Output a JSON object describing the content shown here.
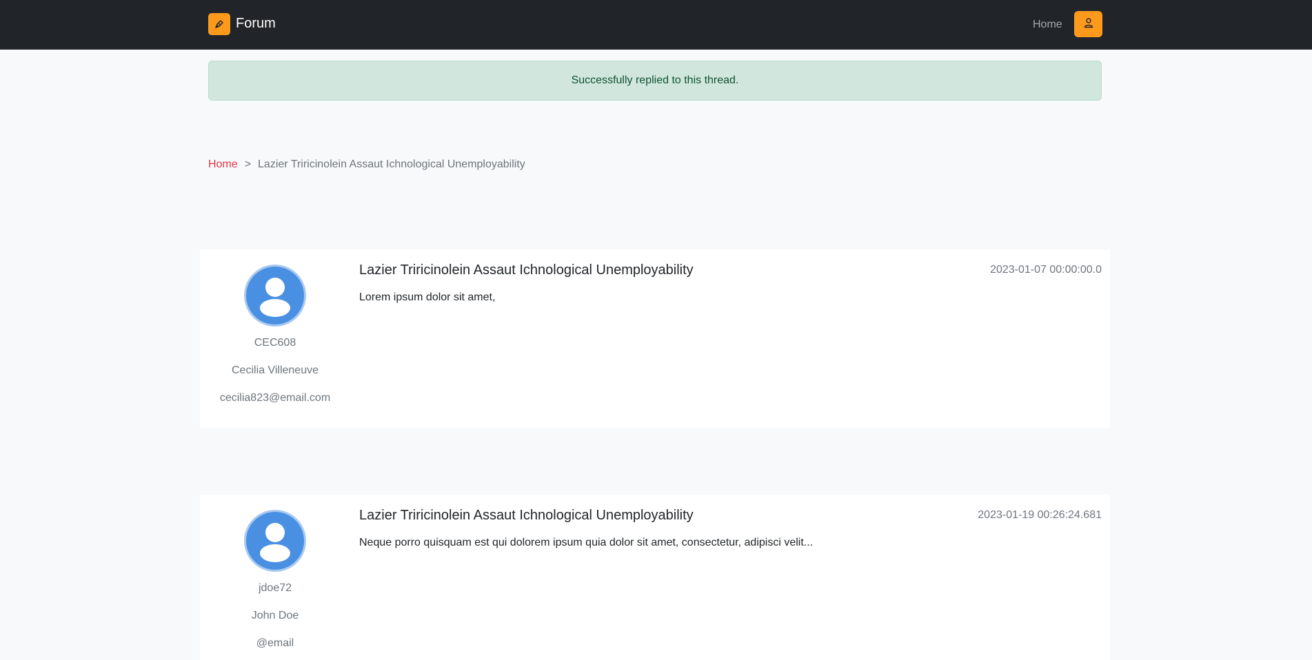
{
  "navbar": {
    "brand": "Forum",
    "brand_icon": "pen-nib-icon",
    "home_link": "Home",
    "user_icon": "user-icon",
    "accent_color": "#fd9a1c"
  },
  "alert": {
    "message": "Successfully replied to this thread."
  },
  "breadcrumb": {
    "home": "Home",
    "separator": ">",
    "current": "Lazier Triricinolein Assaut Ichnological Unemployability"
  },
  "posts": [
    {
      "username": "CEC608",
      "full_name": "Cecilia Villeneuve",
      "email": "cecilia823@email.com",
      "title": "Lazier Triricinolein Assaut Ichnological Unemployability",
      "timestamp": "2023-01-07 00:00:00.0",
      "body": "Lorem ipsum dolor sit amet,"
    },
    {
      "username": "jdoe72",
      "full_name": "John Doe",
      "email": "@email",
      "title": "Lazier Triricinolein Assaut Ichnological Unemployability",
      "timestamp": "2023-01-19 00:26:24.681",
      "body": "Neque porro quisquam est qui dolorem ipsum quia dolor sit amet, consectetur, adipisci velit..."
    }
  ]
}
